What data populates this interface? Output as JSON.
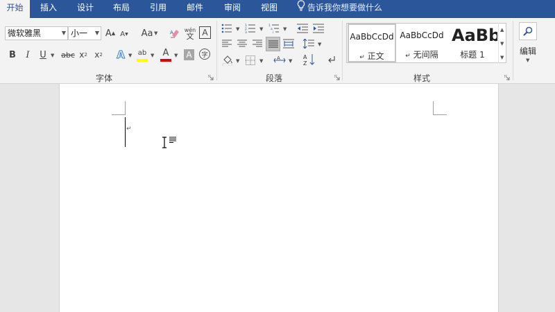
{
  "tabs": [
    "开始",
    "插入",
    "设计",
    "布局",
    "引用",
    "邮件",
    "审阅",
    "视图"
  ],
  "active_tab": "开始",
  "tell_me": "告诉我你想要做什么",
  "font": {
    "family": "微软雅黑",
    "size": "小一",
    "grow_label": "A",
    "shrink_label": "A",
    "case_label": "Aa",
    "phonetic_label": "wén",
    "phonetic_char": "文",
    "border_char": "A",
    "bold": "B",
    "italic": "I",
    "underline": "U",
    "strike": "abc",
    "sub": "x",
    "sub_mark": "2",
    "sup": "x",
    "sup_mark": "2",
    "effects_char": "A",
    "highlight_char": "ab",
    "color_char": "A",
    "shading_char": "A",
    "enclose_char": "字",
    "group_label": "字体"
  },
  "paragraph": {
    "group_label": "段落"
  },
  "styles": {
    "group_label": "样式",
    "items": [
      {
        "preview": "AaBbCcDd",
        "name": "正文",
        "mark": "↵"
      },
      {
        "preview": "AaBbCcDd",
        "name": "无间隔",
        "mark": "↵"
      },
      {
        "preview": "AaBbC",
        "name": "标题 1",
        "mark": ""
      }
    ]
  },
  "editing": {
    "label": "编辑"
  },
  "document": {
    "paragraph_mark": "↵"
  },
  "colors": {
    "tab_bar": "#2b579a",
    "highlight": "#ffff00",
    "font_color": "#e00000"
  }
}
